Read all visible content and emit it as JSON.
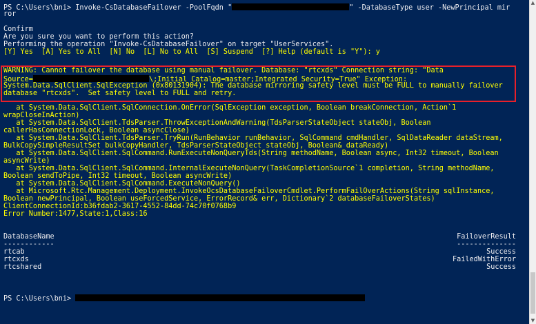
{
  "console": {
    "prompt1": "PS C:\\Users\\bni> Invoke-CsDatabaseFailover -PoolFqdn \"",
    "prompt1_after": "\" -DatabaseType user -NewPrincipal mir",
    "prompt1_wrap": "ror",
    "confirm_title": "Confirm",
    "confirm_question": "Are you sure you want to perform this action?",
    "confirm_operation": "Performing the operation \"Invoke-CsDatabaseFailover\" on target \"UserServices\".",
    "confirm_options": "[Y] Yes  [A] Yes to All  [N] No  [L] No to All  [S] Suspend  [?] Help (default is \"Y\"): y",
    "warning_lines": [
      "WARNING: Cannot failover the database using manual failover. Database: \"rtcxds\" Connection string: \"Data",
      "Source=",
      "\\;Initial Catalog=master;Integrated Security=True\" Exception:",
      "System.Data.SqlClient.SqlException (0x80131904): The database mirroring safety level must be FULL to manually failover",
      "database \"rtcxds\".  Set safety level to FULL and retry."
    ],
    "stack_lines": [
      "   at System.Data.SqlClient.SqlConnection.OnError(SqlException exception, Boolean breakConnection, Action`1",
      "wrapCloseInAction)",
      "   at System.Data.SqlClient.TdsParser.ThrowExceptionAndWarning(TdsParserStateObject stateObj, Boolean",
      "callerHasConnectionLock, Boolean asyncClose)",
      "   at System.Data.SqlClient.TdsParser.TryRun(RunBehavior runBehavior, SqlCommand cmdHandler, SqlDataReader dataStream,",
      "BulkCopySimpleResultSet bulkCopyHandler, TdsParserStateObject stateObj, Boolean& dataReady)",
      "   at System.Data.SqlClient.SqlCommand.RunExecuteNonQueryTds(String methodName, Boolean async, Int32 timeout, Boolean",
      "asyncWrite)",
      "   at System.Data.SqlClient.SqlCommand.InternalExecuteNonQuery(TaskCompletionSource`1 completion, String methodName,",
      "Boolean sendToPipe, Int32 timeout, Boolean asyncWrite)",
      "   at System.Data.SqlClient.SqlCommand.ExecuteNonQuery()",
      "   at Microsoft.Rtc.Management.Deployment.InvokeOcsDatabaseFailoverCmdlet.PerformFailOverActions(String sqlInstance,",
      "Boolean newPrincipal, Boolean useForcedService, ErrorRecord& err, Dictionary`2 databaseFailoverStates)",
      "ClientConnectionId:b36fdab2-3617-4552-84dd-74c70f0768b9",
      "Error Number:1477,State:1,Class:16"
    ],
    "table": {
      "col1_header": "DatabaseName",
      "col1_underline": "------------",
      "col2_header": "FailoverResult",
      "col2_underline": "--------------",
      "rows": [
        {
          "name": "rtcab",
          "result": "Success"
        },
        {
          "name": "rtcxds",
          "result": "FailedWithError"
        },
        {
          "name": "rtcshared",
          "result": "Success"
        }
      ]
    },
    "prompt2": "PS C:\\Users\\bni> "
  },
  "colors": {
    "background": "#012456",
    "text": "#eeedf0",
    "warning_text": "#ffff00",
    "highlight_box": "#e8202a",
    "redaction": "#000000"
  }
}
